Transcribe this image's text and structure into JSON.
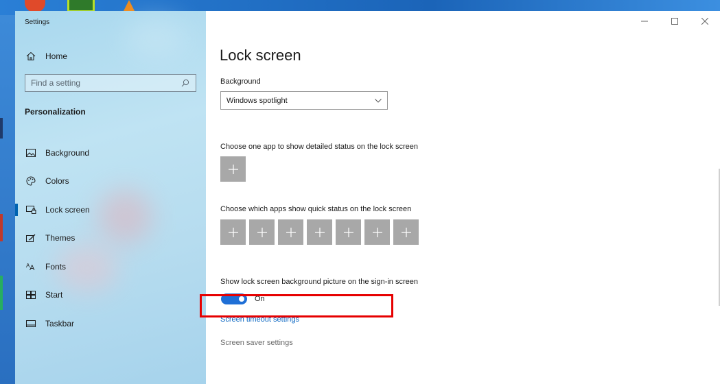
{
  "window": {
    "app_title": "Settings"
  },
  "sidebar": {
    "home_label": "Home",
    "search_placeholder": "Find a setting",
    "section": "Personalization",
    "items": [
      {
        "label": "Background",
        "icon": "picture-icon",
        "selected": false
      },
      {
        "label": "Colors",
        "icon": "palette-icon",
        "selected": false
      },
      {
        "label": "Lock screen",
        "icon": "lock-screen-icon",
        "selected": true
      },
      {
        "label": "Themes",
        "icon": "themes-icon",
        "selected": false
      },
      {
        "label": "Fonts",
        "icon": "fonts-icon",
        "selected": false
      },
      {
        "label": "Start",
        "icon": "start-icon",
        "selected": false
      },
      {
        "label": "Taskbar",
        "icon": "taskbar-icon",
        "selected": false
      }
    ]
  },
  "main": {
    "title": "Lock screen",
    "background_label": "Background",
    "background_value": "Windows spotlight",
    "detailed_status_label": "Choose one app to show detailed status on the lock screen",
    "quick_status_label": "Choose which apps show quick status on the lock screen",
    "quick_status_slots": 7,
    "signin_bg_label": "Show lock screen background picture on the sign-in screen",
    "signin_bg_state": "On",
    "screen_timeout_link": "Screen timeout settings",
    "screen_saver_link": "Screen saver settings"
  },
  "colors": {
    "accent": "#0063b1",
    "toggle_on": "#1f6fd6",
    "link": "#0a66c2",
    "highlight": "#e60000",
    "tile": "#a8a8a8"
  }
}
